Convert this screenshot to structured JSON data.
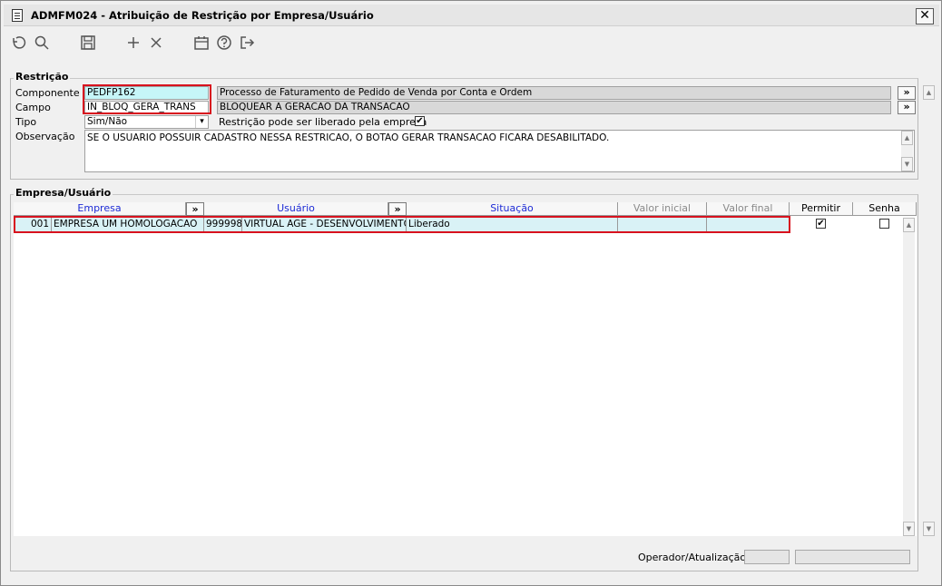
{
  "window": {
    "title": "ADMFM024 - Atribuição de Restrição por Empresa/Usuário",
    "close_label": "✕"
  },
  "toolbar": {
    "icons": [
      "undo-icon",
      "search-icon",
      "save-icon",
      "add-icon",
      "delete-icon",
      "calendar-icon",
      "help-icon",
      "exit-icon"
    ]
  },
  "restricao": {
    "group_label": "Restrição",
    "componente_label": "Componente",
    "componente_value": "PEDFP162",
    "componente_desc": "Processo de Faturamento de Pedido de Venda por Conta e Ordem",
    "campo_label": "Campo",
    "campo_value": "IN_BLOQ_GERA_TRANS",
    "campo_desc": "BLOQUEAR A GERACAO DA TRANSACAO",
    "tipo_label": "Tipo",
    "tipo_value": "Sim/Não",
    "liberado_label": "Restrição pode ser liberado pela empresa",
    "liberado_checked": true,
    "observacao_label": "Observação",
    "observacao_value": "SE O USUARIO POSSUIR CADASTRO NESSA RESTRICAO, O BOTAO GERAR TRANSACAO FICARA DESABILITADO.",
    "more_label": "»"
  },
  "empresa_usuario": {
    "group_label": "Empresa/Usuário",
    "columns": {
      "empresa": "Empresa",
      "usuario": "Usuário",
      "situacao": "Situação",
      "valor_inicial": "Valor inicial",
      "valor_final": "Valor final",
      "permitir": "Permitir",
      "senha": "Senha"
    },
    "more_label": "»",
    "rows": [
      {
        "empresa_code": "001",
        "empresa_name": "EMPRESA UM HOMOLOGACAO",
        "usuario_code": "999998",
        "usuario_name": "VIRTUAL AGE - DESENVOLVIMENTO",
        "situacao": "Liberado",
        "valor_inicial": "",
        "valor_final": "",
        "permitir": true,
        "senha": false
      }
    ]
  },
  "status": {
    "operador_label": "Operador/Atualização"
  }
}
